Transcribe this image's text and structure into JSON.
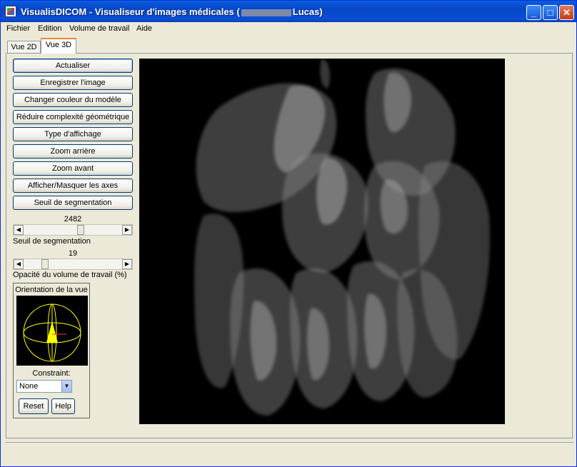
{
  "window": {
    "title_prefix": "VisualisDICOM - Visualiseur d'images médicales (",
    "title_suffix": "Lucas)",
    "controls": {
      "minimize": "_",
      "maximize": "□",
      "close": "✕"
    }
  },
  "menu": [
    "Fichier",
    "Edition",
    "Volume de travail",
    "Aide"
  ],
  "tabs": [
    {
      "label": "Vue 2D",
      "active": false
    },
    {
      "label": "Vue 3D",
      "active": true
    }
  ],
  "buttons": {
    "refresh": "Actualiser",
    "save_image": "Enregistrer l'image",
    "change_color": "Changer couleur du modèle",
    "reduce_complexity": "Réduire complexité géométrique",
    "display_type": "Type d'affichage",
    "zoom_out": "Zoom arrière",
    "zoom_in": "Zoom avant",
    "toggle_axes": "Afficher/Masquer les axes",
    "segmentation_threshold": "Seuil de segmentation"
  },
  "sliders": {
    "threshold": {
      "value": "2482",
      "label": "Seuil de segmentation",
      "position": 0.58
    },
    "opacity": {
      "value": "19",
      "label": "Opacité du volume de travail (%)",
      "position": 0.19
    }
  },
  "orientation": {
    "title": "Orientation de la vue",
    "constraint_label": "Constraint:",
    "constraint_value": "None",
    "reset": "Reset",
    "help": "Help"
  },
  "colors": {
    "title_bar": "#0a5ddf",
    "viewport_bg": "#000000",
    "gizmo": "#ffff00"
  }
}
